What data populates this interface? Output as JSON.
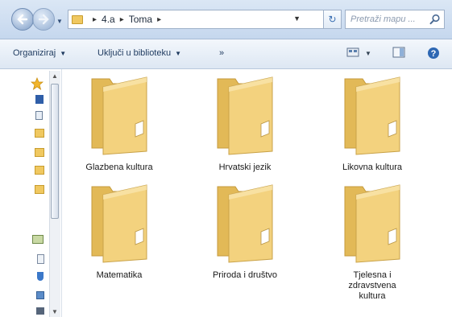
{
  "address_bar": {
    "path": [
      "4.a",
      "Toma"
    ],
    "search_placeholder": "Pretraži mapu ..."
  },
  "toolbar": {
    "organize_label": "Organiziraj",
    "include_library_label": "Uključi u biblioteku"
  },
  "folders": [
    {
      "label": "Glazbena kultura"
    },
    {
      "label": "Hrvatski jezik"
    },
    {
      "label": "Likovna kultura"
    },
    {
      "label": "Matematika"
    },
    {
      "label": "Priroda i društvo"
    },
    {
      "label": "Tjelesna i zdravstvena kultura"
    }
  ],
  "colors": {
    "folder_fill": "#f3d27e",
    "folder_shade": "#e2b957",
    "accent": "#3a6fb2"
  },
  "icons": [
    "back-arrow-icon",
    "forward-arrow-icon",
    "refresh-icon",
    "search-icon",
    "help-icon",
    "preview-pane-icon",
    "change-view-icon",
    "favorites-star-icon"
  ]
}
